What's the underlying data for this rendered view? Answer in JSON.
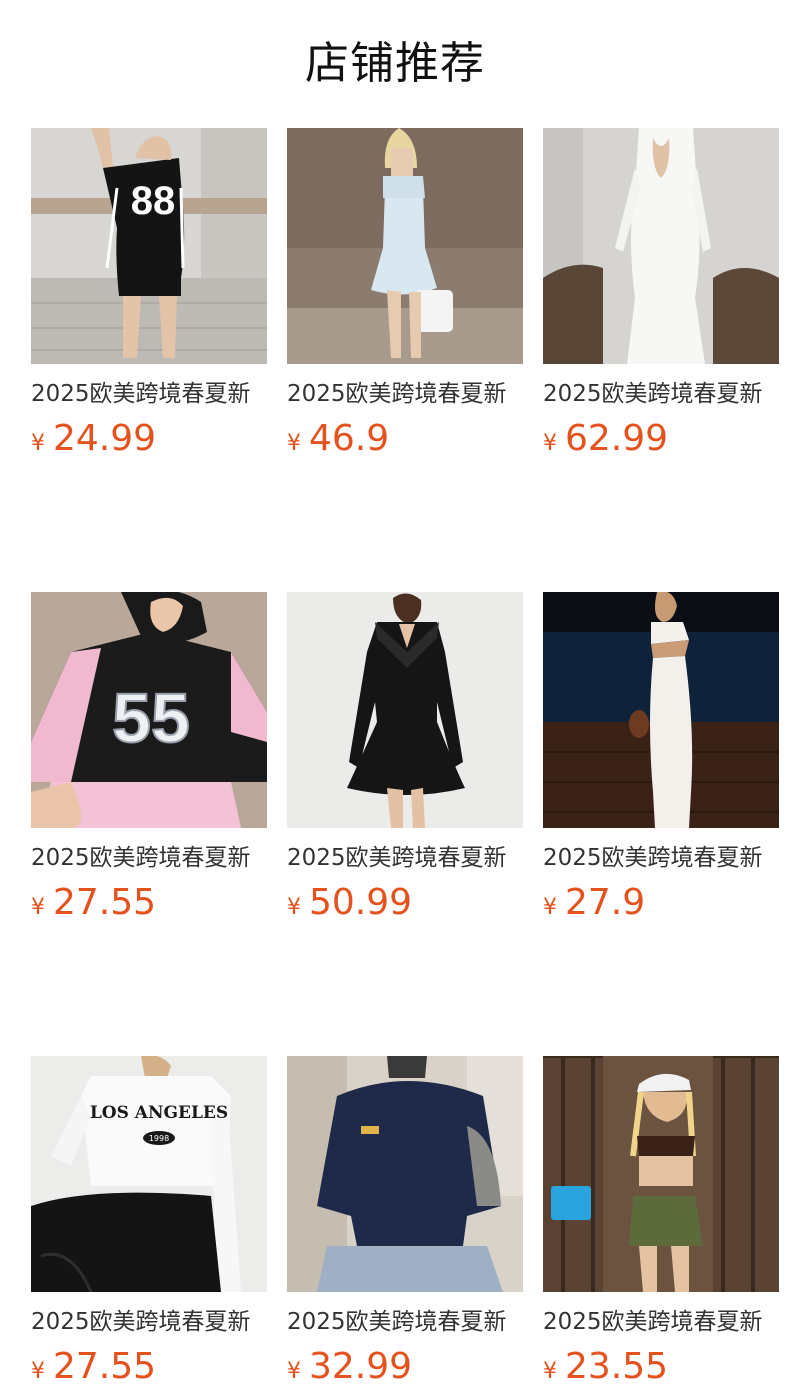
{
  "header": {
    "title": "店铺推荐"
  },
  "currency_symbol": "¥",
  "products": [
    {
      "title": "2025欧美跨境春夏新",
      "price": "24.99"
    },
    {
      "title": "2025欧美跨境春夏新",
      "price": "46.9"
    },
    {
      "title": "2025欧美跨境春夏新",
      "price": "62.99"
    },
    {
      "title": "2025欧美跨境春夏新",
      "price": "27.55"
    },
    {
      "title": "2025欧美跨境春夏新",
      "price": "50.99"
    },
    {
      "title": "2025欧美跨境春夏新",
      "price": "27.9"
    },
    {
      "title": "2025欧美跨境春夏新",
      "price": "27.55"
    },
    {
      "title": "2025欧美跨境春夏新",
      "price": "32.99"
    },
    {
      "title": "2025欧美跨境春夏新",
      "price": "23.55"
    }
  ],
  "jersey_numbers": [
    "88",
    "55"
  ],
  "shirt_print": {
    "text": "LOS ANGELES",
    "year": "1998"
  },
  "colors": {
    "price": "#e4521d",
    "title_text": "#333333",
    "heading": "#111111"
  }
}
